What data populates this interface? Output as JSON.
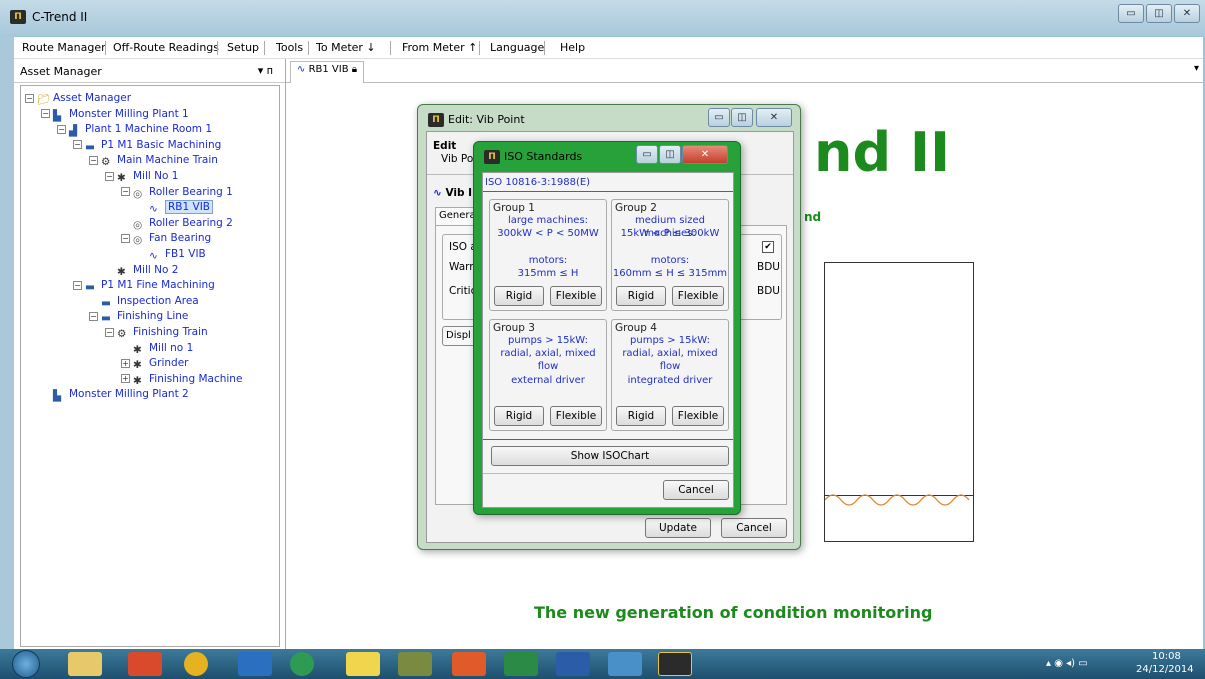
{
  "window": {
    "title": "C-Trend II",
    "app_icon": "Π"
  },
  "menu": [
    "Route Manager",
    "Off-Route Readings",
    "Setup",
    "Tools",
    "To Meter ↓",
    "From Meter ↑",
    "Language",
    "Help"
  ],
  "asset_manager": {
    "title": "Asset Manager",
    "pin": "▾ ᴨ"
  },
  "tree": [
    {
      "label": "Asset Manager",
      "level": 0,
      "icon": "folder-icon"
    },
    {
      "label": "Monster Milling Plant 1",
      "level": 1,
      "icon": "plant-icon"
    },
    {
      "label": "Plant 1 Machine Room 1",
      "level": 2,
      "icon": "room-icon"
    },
    {
      "label": "P1 M1 Basic Machining",
      "level": 3,
      "icon": "area-icon"
    },
    {
      "label": "Main Machine Train",
      "level": 4,
      "icon": "train-icon"
    },
    {
      "label": "Mill No 1",
      "level": 5,
      "icon": "machine-icon"
    },
    {
      "label": "Roller Bearing 1",
      "level": 6,
      "icon": "bearing-icon"
    },
    {
      "label": "RB1 VIB",
      "level": 7,
      "icon": "vib-icon"
    },
    {
      "label": "Roller Bearing 2",
      "level": 6,
      "icon": "bearing-icon"
    },
    {
      "label": "Fan Bearing",
      "level": 6,
      "icon": "bearing-icon"
    },
    {
      "label": "FB1 VIB",
      "level": 7,
      "icon": "vib-icon"
    },
    {
      "label": "Mill No 2",
      "level": 5,
      "icon": "machine-icon"
    },
    {
      "label": "P1 M1 Fine Machining",
      "level": 3,
      "icon": "area-icon"
    },
    {
      "label": "Inspection Area",
      "level": 4,
      "icon": "area-icon"
    },
    {
      "label": "Finishing Line",
      "level": 4,
      "icon": "area-icon"
    },
    {
      "label": "Finishing Train",
      "level": 5,
      "icon": "train-icon"
    },
    {
      "label": "Mill no 1",
      "level": 6,
      "icon": "machine-icon"
    },
    {
      "label": "Grinder",
      "level": 6,
      "icon": "machine-icon"
    },
    {
      "label": "Finishing Machine",
      "level": 6,
      "icon": "machine-icon"
    },
    {
      "label": "Monster Milling Plant 2",
      "level": 1,
      "icon": "plant-icon"
    }
  ],
  "doc_tab": {
    "label": "RB1 VIB"
  },
  "splash": {
    "title": "nd II",
    "tagline_fragment": "nd",
    "subtitle": "The new generation of condition monitoring"
  },
  "edit_dialog": {
    "title": "Edit: Vib Point",
    "edit_label": "Edit",
    "vib_point_label": "Vib Po",
    "vib_label": "Vib I",
    "tab_general": "Genera",
    "iso_label": "ISO a",
    "warn_label": "Warni",
    "critical_label": "Critica",
    "display_label": "Displ",
    "bdu1": "BDU",
    "bdu2": "BDU",
    "update": "Update",
    "cancel": "Cancel"
  },
  "iso_dialog": {
    "title": "ISO Standards",
    "standard": "ISO 10816-3:1988(E)",
    "groups": [
      {
        "name": "Group 1",
        "lines": [
          "large machines:",
          "300kW < P < 50MW",
          "",
          "motors:",
          "315mm ≤ H"
        ],
        "rigid": "Rigid",
        "flexible": "Flexible"
      },
      {
        "name": "Group 2",
        "lines": [
          "medium sized machines:",
          "15kW < P ≤ 300kW",
          "",
          "motors:",
          "160mm ≤ H ≤ 315mm"
        ],
        "rigid": "Rigid",
        "flexible": "Flexible"
      },
      {
        "name": "Group 3",
        "lines": [
          "pumps > 15kW:",
          "radial, axial, mixed flow",
          "",
          "external driver"
        ],
        "rigid": "Rigid",
        "flexible": "Flexible"
      },
      {
        "name": "Group 4",
        "lines": [
          "pumps > 15kW:",
          "radial, axial, mixed flow",
          "",
          "integrated driver"
        ],
        "rigid": "Rigid",
        "flexible": "Flexible"
      }
    ],
    "show_chart": "Show ISOChart",
    "cancel": "Cancel"
  },
  "taskbar": {
    "time": "10:08",
    "date": "24/12/2014"
  }
}
